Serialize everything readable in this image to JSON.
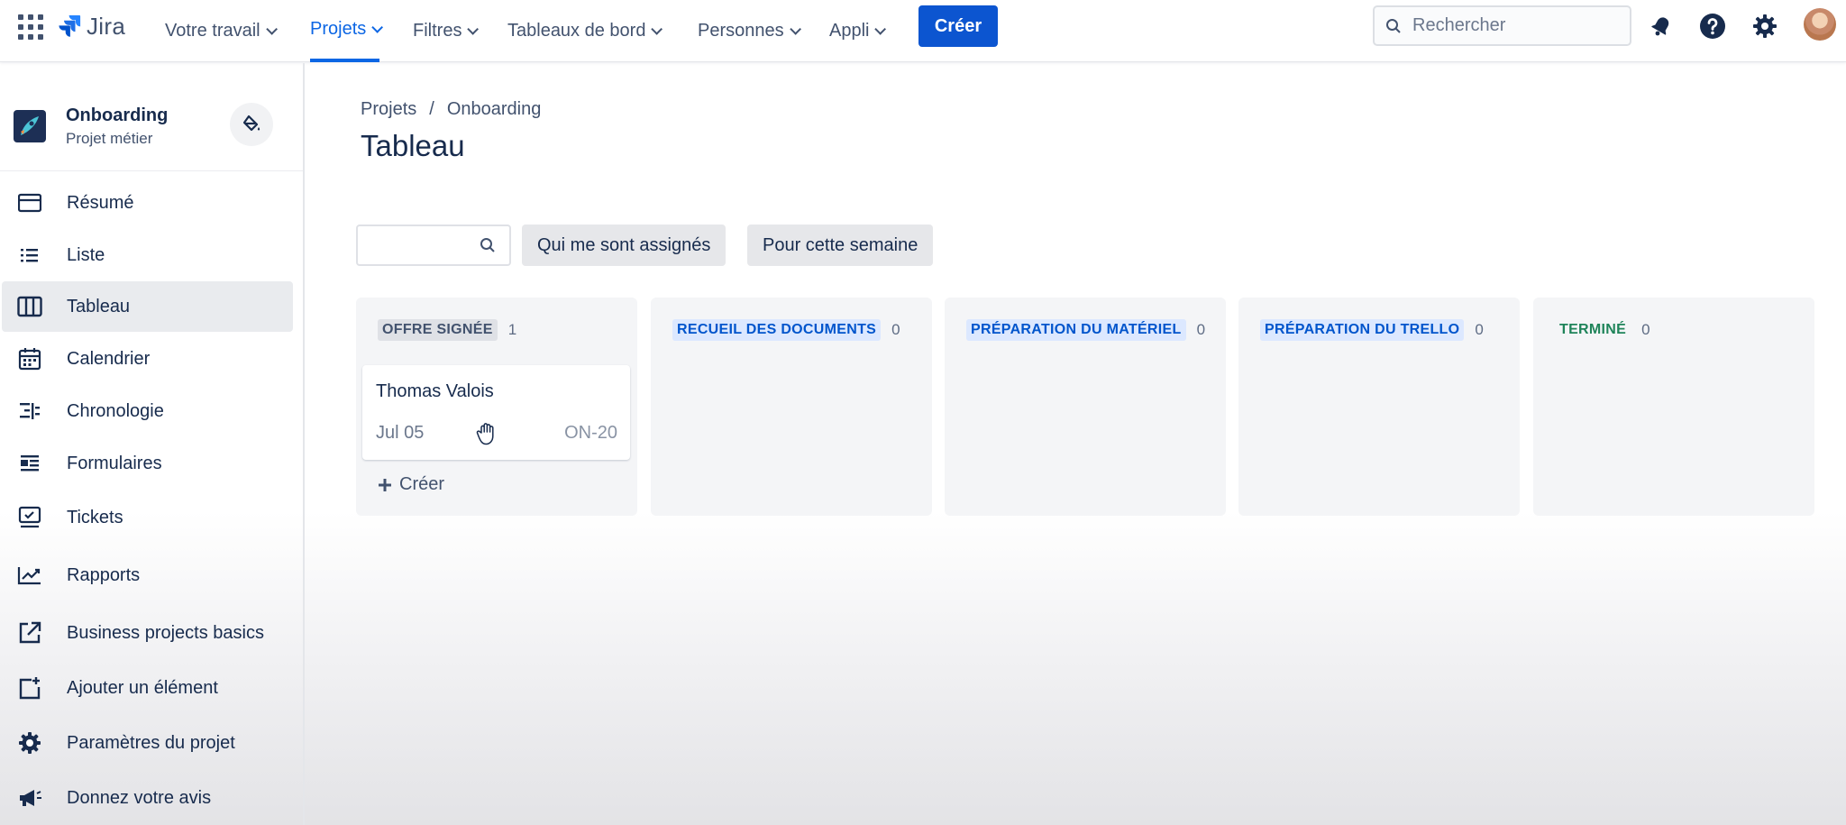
{
  "app": {
    "name": "Jira"
  },
  "topnav": {
    "items": [
      {
        "label": "Votre travail"
      },
      {
        "label": "Projets",
        "active": true
      },
      {
        "label": "Filtres"
      },
      {
        "label": "Tableaux de bord"
      },
      {
        "label": "Personnes"
      },
      {
        "label": "Appli"
      }
    ],
    "create_label": "Créer",
    "search_placeholder": "Rechercher",
    "icons": [
      "apps-grid-icon",
      "jira-logo-icon",
      "search-icon",
      "notifications-icon",
      "help-icon",
      "settings-icon",
      "avatar"
    ]
  },
  "sidebar": {
    "project_name": "Onboarding",
    "project_type": "Projet métier",
    "items": [
      {
        "label": "Résumé",
        "icon": "summary-icon"
      },
      {
        "label": "Liste",
        "icon": "list-icon"
      },
      {
        "label": "Tableau",
        "icon": "board-icon",
        "active": true
      },
      {
        "label": "Calendrier",
        "icon": "calendar-icon"
      },
      {
        "label": "Chronologie",
        "icon": "timeline-icon"
      },
      {
        "label": "Formulaires",
        "icon": "forms-icon"
      },
      {
        "label": "Tickets",
        "icon": "tickets-icon"
      },
      {
        "label": "Rapports",
        "icon": "reports-icon"
      },
      {
        "label": "Business projects basics",
        "icon": "external-link-icon"
      },
      {
        "label": "Ajouter un élément",
        "icon": "add-item-icon"
      },
      {
        "label": "Paramètres du projet",
        "icon": "gear-icon"
      },
      {
        "label": "Donnez votre avis",
        "icon": "megaphone-icon"
      }
    ]
  },
  "main": {
    "breadcrumb": [
      "Projets",
      "Onboarding"
    ],
    "breadcrumb_sep": "/",
    "title": "Tableau",
    "filters": [
      "Qui me sont assignés",
      "Pour cette semaine"
    ]
  },
  "board": {
    "columns": [
      {
        "title": "OFFRE SIGNÉE",
        "count": "1",
        "color": "#42526e",
        "bg": "#dfe1e6"
      },
      {
        "title": "RECUEIL DES DOCUMENTS",
        "count": "0",
        "color": "#0055cc",
        "bg": "#dce8ff"
      },
      {
        "title": "PRÉPARATION DU MATÉRIEL",
        "count": "0",
        "color": "#0055cc",
        "bg": "#dce8ff"
      },
      {
        "title": "PRÉPARATION DU TRELLO",
        "count": "0",
        "color": "#0055cc",
        "bg": "#dce8ff"
      },
      {
        "title": "TERMINÉ",
        "count": "0",
        "color": "#1f845a",
        "bg": "transparent"
      }
    ],
    "card": {
      "title": "Thomas Valois",
      "date": "Jul 05",
      "key": "ON-20"
    },
    "create_label": "Créer"
  }
}
